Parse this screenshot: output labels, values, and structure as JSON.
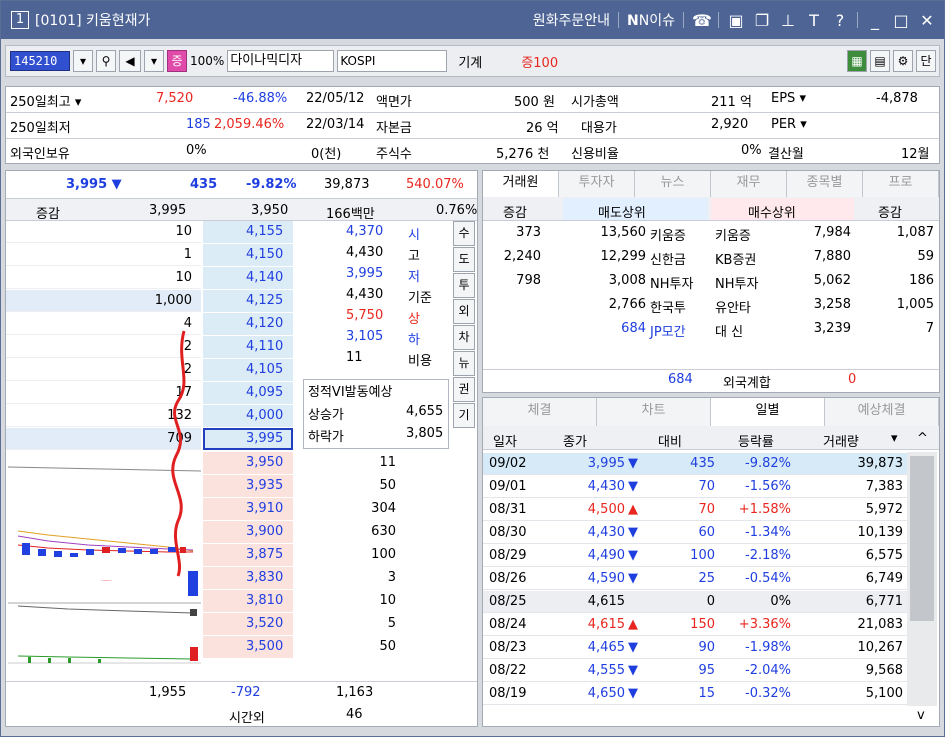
{
  "window": {
    "number": "1",
    "title": "[0101] 키움현재가",
    "links": [
      "원화주문안내",
      "N이슈"
    ],
    "icons": [
      "phone-icon",
      "tile-icon",
      "window-icon",
      "pin-icon",
      "font-icon",
      "help-icon",
      "minimize-icon",
      "maximize-icon",
      "close-icon"
    ]
  },
  "toolbar": {
    "code": "145210",
    "mode": "증",
    "percent": "100%",
    "name": "다이나믹디자",
    "market": "KOSPI",
    "label1": "기계",
    "label2": "증100",
    "right": "단"
  },
  "info": {
    "r1": {
      "k": "250일최고",
      "v": "7,520",
      "p": "-46.88%",
      "d": "22/05/12",
      "k2": "액면가",
      "v2": "500 원",
      "k3": "시가총액",
      "v3": "211 억",
      "k4": "EPS",
      "v4": "-4,878"
    },
    "r2": {
      "k": "250일최저",
      "v": "185",
      "p": "2,059.46%",
      "d": "22/03/14",
      "k2": "자본금",
      "v2": "26 억",
      "k3": "대용가",
      "v3": "2,920",
      "k4": "PER",
      "v4": ""
    },
    "r3": {
      "k": "외국인보유",
      "v": "0%",
      "d": "0(천)",
      "k2": "주식수",
      "v2": "5,276 천",
      "k3": "신용비율",
      "v3": "0%",
      "k4": "결산월",
      "v4": "12월"
    }
  },
  "quote": {
    "price": "3,995",
    "change": "435",
    "rate": "-9.82%",
    "volume": "39,873",
    "vol_rate": "540.07%",
    "h_label": "증감",
    "h_price": "3,995",
    "h_price2": "3,950",
    "h_amt": "166백만",
    "h_pct": "0.76%"
  },
  "asks": [
    [
      "10",
      "4,155"
    ],
    [
      "1",
      "4,150"
    ],
    [
      "10",
      "4,140"
    ],
    [
      "1,000",
      "4,125"
    ],
    [
      "4",
      "4,120"
    ],
    [
      "2",
      "4,110"
    ],
    [
      "2",
      "4,105"
    ],
    [
      "17",
      "4,095"
    ],
    [
      "132",
      "4,000"
    ],
    [
      "709",
      "3,995"
    ]
  ],
  "bids": [
    [
      "3,950",
      "11"
    ],
    [
      "3,935",
      "50"
    ],
    [
      "3,910",
      "304"
    ],
    [
      "3,900",
      "630"
    ],
    [
      "3,875",
      "100"
    ],
    [
      "3,830",
      "3"
    ],
    [
      "3,810",
      "10"
    ],
    [
      "3,520",
      "5"
    ],
    [
      "3,500",
      "50"
    ]
  ],
  "midinfo": [
    [
      "4,370",
      "시"
    ],
    [
      "4,430",
      "고"
    ],
    [
      "3,995",
      "저"
    ],
    [
      "4,430",
      "기준"
    ],
    [
      "5,750",
      "상"
    ],
    [
      "3,105",
      "하"
    ],
    [
      "11",
      "비용"
    ]
  ],
  "vi": {
    "title": "정적VI발동예상",
    "up_l": "상승가",
    "up_v": "4,655",
    "dn_l": "하락가",
    "dn_v": "3,805"
  },
  "sidebtns": [
    "수",
    "도",
    "투",
    "외",
    "차",
    "뉴",
    "권",
    "기"
  ],
  "bottom": {
    "a": "1,955",
    "b": "-792",
    "c": "1,163",
    "d": "시간외",
    "e": "46"
  },
  "broker": {
    "tabs": [
      "거래원",
      "투자자",
      "뉴스",
      "재무",
      "종목별",
      "프로"
    ],
    "hdr": [
      "증감",
      "매도상위",
      "매수상위",
      "증감"
    ],
    "rows": [
      [
        "373",
        "13,560",
        "키움증",
        "키움증",
        "7,984",
        "1,087"
      ],
      [
        "2,240",
        "12,299",
        "신한금",
        "KB증권",
        "7,880",
        "59"
      ],
      [
        "798",
        "3,008",
        "NH투자",
        "NH투자",
        "5,062",
        "186"
      ],
      [
        "",
        "2,766",
        "한국투",
        "유안타",
        "3,258",
        "1,005"
      ],
      [
        "",
        "684",
        "JP모간",
        "대 신",
        "3,239",
        "7"
      ]
    ],
    "foreign": {
      "v": "684",
      "l": "외국계합",
      "r": "0"
    }
  },
  "daily": {
    "tabs": [
      "체결",
      "차트",
      "일별",
      "예상체결"
    ],
    "hdr": [
      "일자",
      "종가",
      "대비",
      "등락률",
      "거래량"
    ],
    "rows": [
      [
        "09/02",
        "3,995",
        "▼",
        "435",
        "-9.82%",
        "39,873"
      ],
      [
        "09/01",
        "4,430",
        "▼",
        "70",
        "-1.56%",
        "7,383"
      ],
      [
        "08/31",
        "4,500",
        "▲",
        "70",
        "+1.58%",
        "5,972"
      ],
      [
        "08/30",
        "4,430",
        "▼",
        "60",
        "-1.34%",
        "10,139"
      ],
      [
        "08/29",
        "4,490",
        "▼",
        "100",
        "-2.18%",
        "6,575"
      ],
      [
        "08/26",
        "4,590",
        "▼",
        "25",
        "-0.54%",
        "6,749"
      ],
      [
        "08/25",
        "4,615",
        "",
        "0",
        "0%",
        "6,771"
      ],
      [
        "08/24",
        "4,615",
        "▲",
        "150",
        "+3.36%",
        "21,083"
      ],
      [
        "08/23",
        "4,465",
        "▼",
        "90",
        "-1.98%",
        "10,267"
      ],
      [
        "08/22",
        "4,555",
        "▼",
        "95",
        "-2.04%",
        "9,568"
      ],
      [
        "08/19",
        "4,650",
        "▼",
        "15",
        "-0.32%",
        "5,100"
      ]
    ]
  }
}
